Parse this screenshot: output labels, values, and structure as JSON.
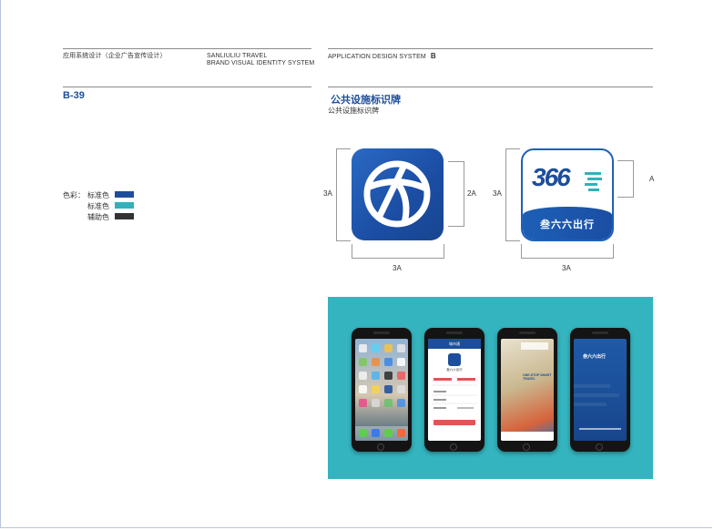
{
  "header": {
    "left_title": "应用系统设计（企业广告宣传设计）",
    "brand_line1": "SANLIULIU TRAVEL",
    "brand_line2": "BRAND VISUAL IDENTITY SYSTEM",
    "app_system": "APPLICATION DESIGN SYSTEM",
    "section_letter": "B"
  },
  "page_code": "B-39",
  "content": {
    "title": "公共设施标识牌",
    "subtitle": "公共设施标识牌"
  },
  "colors_legend": {
    "label": "色彩：",
    "items": [
      {
        "label": "标准色",
        "color": "#1c4e9c"
      },
      {
        "label": "标准色",
        "color": "#2fb3b9"
      },
      {
        "label": "辅助色",
        "color": "#333333"
      }
    ]
  },
  "dimensions": {
    "blue_icon_height": "3A",
    "blue_icon_width": "3A",
    "blue_icon_inner": "2A",
    "white_icon_height": "3A",
    "white_icon_width": "3A",
    "white_icon_side": "A"
  },
  "logo": {
    "number_mark": "366",
    "band_text": "叁六六出行"
  },
  "phones": [
    {
      "type": "ios-home"
    },
    {
      "type": "app-login",
      "header_text": "城市通",
      "brand": "叁六六出行"
    },
    {
      "type": "ad",
      "headline": "ONE-STOP SMART TRAVEL"
    },
    {
      "type": "splash",
      "brand": "叁六六出行"
    }
  ],
  "palette": {
    "brand_blue": "#1c4e9c",
    "brand_teal": "#34b4be"
  }
}
